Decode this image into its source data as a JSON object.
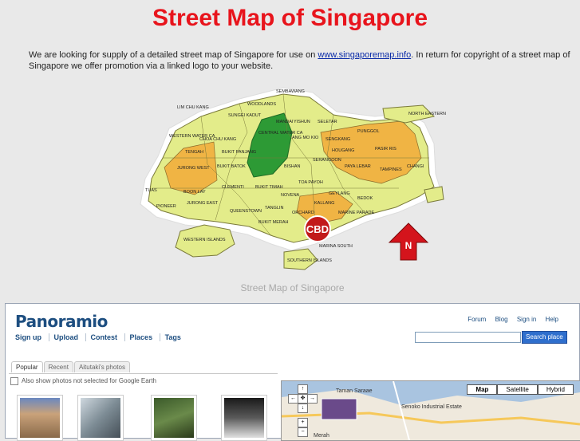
{
  "header": {
    "title": "Street Map of Singapore",
    "intro_before": "We are looking for supply of a detailed street map of Singapore for use on ",
    "intro_link": "www.singaporemap.info",
    "intro_after": ". In return for copyright of a street map of Singapore we offer promotion via a linked logo to your website."
  },
  "map": {
    "caption": "Street Map of Singapore",
    "cbd_badge": "CBD",
    "north_label": "N",
    "labels": [
      "SEMBAWANG",
      "LIM CHU KANG",
      "WOODLANDS",
      "SUNGEI KADUT",
      "MANDAI",
      "YISHUN",
      "SELETAR",
      "NORTH EASTERN ISLANDS",
      "WESTERN WATER CA",
      "CHOA CHU KANG",
      "CENTRAL WATER CA",
      "ANG MO KIO",
      "SENGKANG",
      "PUNGGOL",
      "PASIR RIS",
      "TENGAH",
      "BUKIT PANJANG",
      "HOUGANG",
      "PAYA LEBAR",
      "TAMPINES",
      "CHANGI",
      "JURONG WEST",
      "BUKIT BATOK",
      "BISHAN",
      "SERANGOON",
      "TUAS",
      "BOON LAY",
      "CLEMENTI",
      "BUKIT TIMAH",
      "TOA PAYOH",
      "GEYLANG",
      "BEDOK",
      "JURONG EAST",
      "NOVENA",
      "KALLANG",
      "PIONEER",
      "QUEENSTOWN",
      "TANGLIN",
      "ORCHARD",
      "MARINE PARADE",
      "WESTERN ISLANDS",
      "BUKIT MERAH",
      "MARINA SOUTH",
      "SOUTHERN ISLANDS"
    ]
  },
  "panoramio": {
    "logo": "Panoramio",
    "top_links": [
      "Forum",
      "Blog",
      "Sign in",
      "Help"
    ],
    "nav": [
      "Sign up",
      "Upload",
      "Contest",
      "Places",
      "Tags"
    ],
    "search_button": "Search place",
    "tabs": [
      "Popular",
      "Recent",
      "Aitutaki's photos"
    ],
    "checkbox_label": "Also show photos not selected for Google Earth",
    "map_types": [
      "Map",
      "Satellite",
      "Hybrid"
    ],
    "map_labels": [
      "Taman Saraae",
      "Senoko Industrial Estate",
      "Merah"
    ]
  },
  "colors": {
    "title": "#e8141c",
    "link": "#0a2ba8",
    "logo": "#1d4e80",
    "land": "#e3ec8a",
    "water_ca": "#2d9a35",
    "highlight": "#f0b444"
  }
}
